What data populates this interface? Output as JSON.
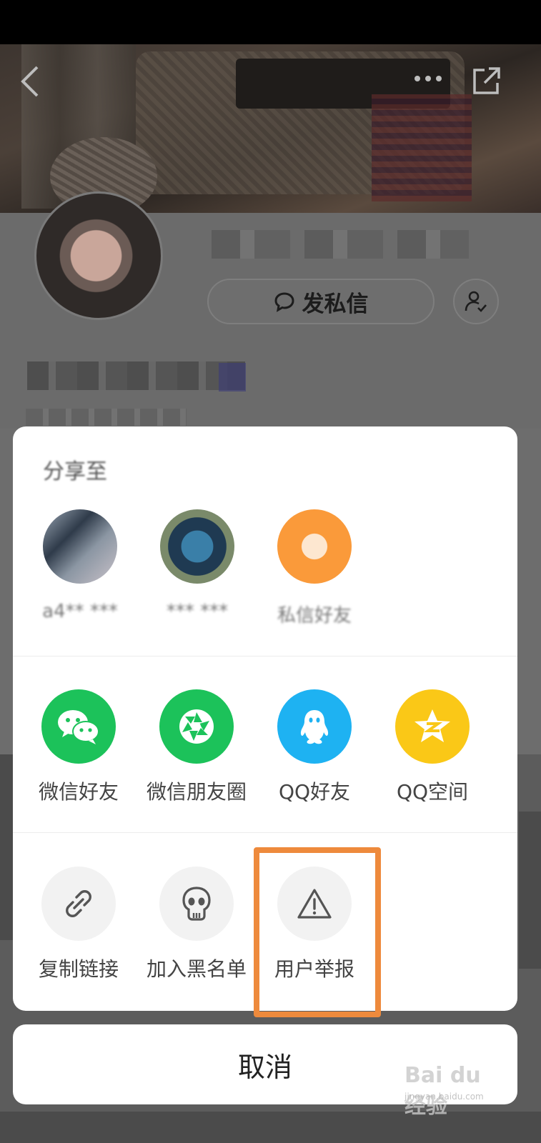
{
  "header": {
    "back_icon": "chevron-left-icon",
    "more_icon": "more-dots-icon",
    "share_icon": "share-out-icon"
  },
  "profile": {
    "dm_label": "发私信",
    "dm_icon": "chat-bubble-icon",
    "follow_icon": "user-check-icon"
  },
  "sheet": {
    "title": "分享至",
    "friends": [
      {
        "label": "a4** ***"
      },
      {
        "label": "*** ***"
      },
      {
        "label": "私信好友"
      }
    ],
    "share_options": [
      {
        "label": "微信好友",
        "icon": "wechat-icon",
        "color": "#1cc25a"
      },
      {
        "label": "微信朋友圈",
        "icon": "moments-icon",
        "color": "#1cc25a"
      },
      {
        "label": "QQ好友",
        "icon": "qq-icon",
        "color": "#1eb2f2"
      },
      {
        "label": "QQ空间",
        "icon": "qzone-icon",
        "color": "#fac817"
      }
    ],
    "actions": [
      {
        "label": "复制链接",
        "icon": "link-icon"
      },
      {
        "label": "加入黑名单",
        "icon": "skull-icon"
      },
      {
        "label": "用户举报",
        "icon": "warning-icon"
      }
    ],
    "highlight_color": "#ee8a3c"
  },
  "cancel_label": "取消",
  "watermark": {
    "main": "Bai du 经验",
    "sub": "jingyan.baidu.com"
  }
}
